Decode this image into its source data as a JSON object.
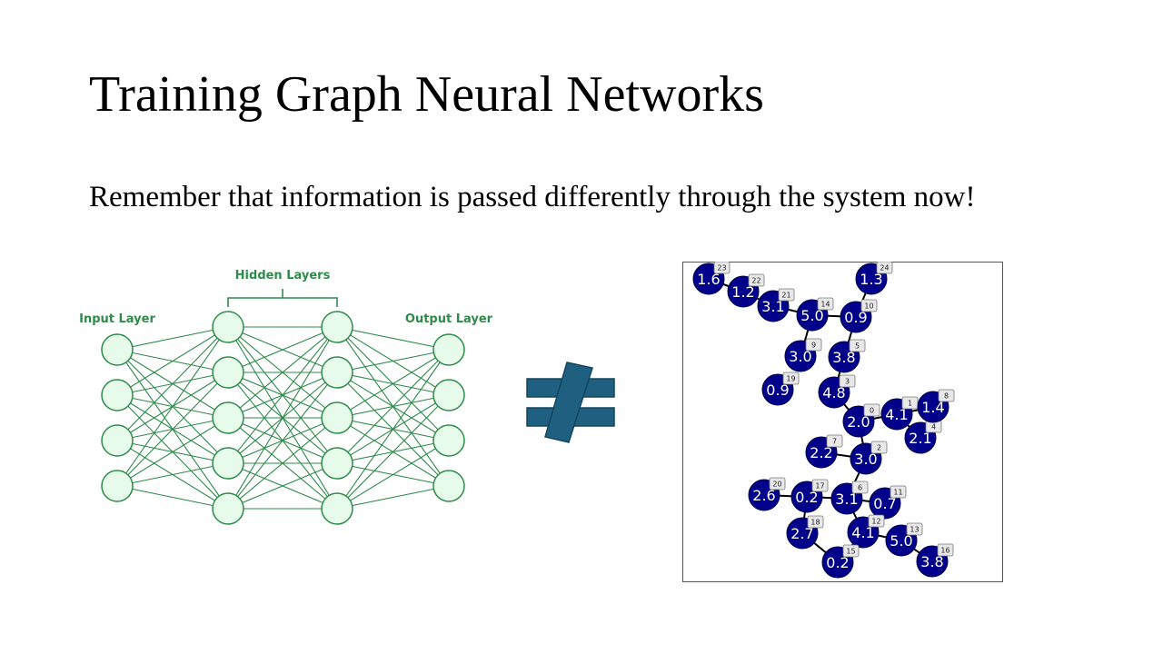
{
  "slide": {
    "title": "Training Graph Neural Networks",
    "body": "Remember that information is passed differently through the system now!"
  },
  "nn_diagram": {
    "input_label": "Input Layer",
    "hidden_label": "Hidden Layers",
    "output_label": "Output Layer",
    "layer_sizes": [
      4,
      5,
      5,
      4
    ],
    "color": "#2e8b4a",
    "node_fill": "#e6fbe9"
  },
  "symbol": {
    "name": "not-equal-icon",
    "color": "#1f6080"
  },
  "graph": {
    "node_color": "#00008b",
    "nodes": [
      {
        "id": "0",
        "val": "2.0"
      },
      {
        "id": "1",
        "val": "4.1"
      },
      {
        "id": "2",
        "val": "3.0"
      },
      {
        "id": "3",
        "val": "4.8"
      },
      {
        "id": "4",
        "val": "2.1"
      },
      {
        "id": "5",
        "val": "3.8"
      },
      {
        "id": "6",
        "val": "3.1"
      },
      {
        "id": "7",
        "val": "2.2"
      },
      {
        "id": "8",
        "val": "1.4"
      },
      {
        "id": "9",
        "val": "3.0"
      },
      {
        "id": "10",
        "val": "0.9"
      },
      {
        "id": "11",
        "val": "0.7"
      },
      {
        "id": "12",
        "val": "4.1"
      },
      {
        "id": "13",
        "val": "5.0"
      },
      {
        "id": "14",
        "val": "5.0"
      },
      {
        "id": "15",
        "val": "0.2"
      },
      {
        "id": "16",
        "val": "3.8"
      },
      {
        "id": "17",
        "val": "0.2"
      },
      {
        "id": "18",
        "val": "2.7"
      },
      {
        "id": "19",
        "val": "0.9"
      },
      {
        "id": "20",
        "val": "2.6"
      },
      {
        "id": "21",
        "val": "3.1"
      },
      {
        "id": "22",
        "val": "1.2"
      },
      {
        "id": "23",
        "val": "1.6"
      },
      {
        "id": "24",
        "val": "1.3"
      }
    ],
    "edges": [
      [
        "23",
        "22"
      ],
      [
        "22",
        "21"
      ],
      [
        "21",
        "14"
      ],
      [
        "14",
        "10"
      ],
      [
        "24",
        "10"
      ],
      [
        "14",
        "9"
      ],
      [
        "10",
        "5"
      ],
      [
        "5",
        "3"
      ],
      [
        "3",
        "0"
      ],
      [
        "0",
        "1"
      ],
      [
        "1",
        "8"
      ],
      [
        "1",
        "4"
      ],
      [
        "0",
        "2"
      ],
      [
        "7",
        "2"
      ],
      [
        "2",
        "6"
      ],
      [
        "6",
        "17"
      ],
      [
        "17",
        "20"
      ],
      [
        "17",
        "18"
      ],
      [
        "18",
        "15"
      ],
      [
        "6",
        "11"
      ],
      [
        "6",
        "12"
      ],
      [
        "12",
        "15"
      ],
      [
        "12",
        "13"
      ],
      [
        "13",
        "16"
      ]
    ]
  }
}
